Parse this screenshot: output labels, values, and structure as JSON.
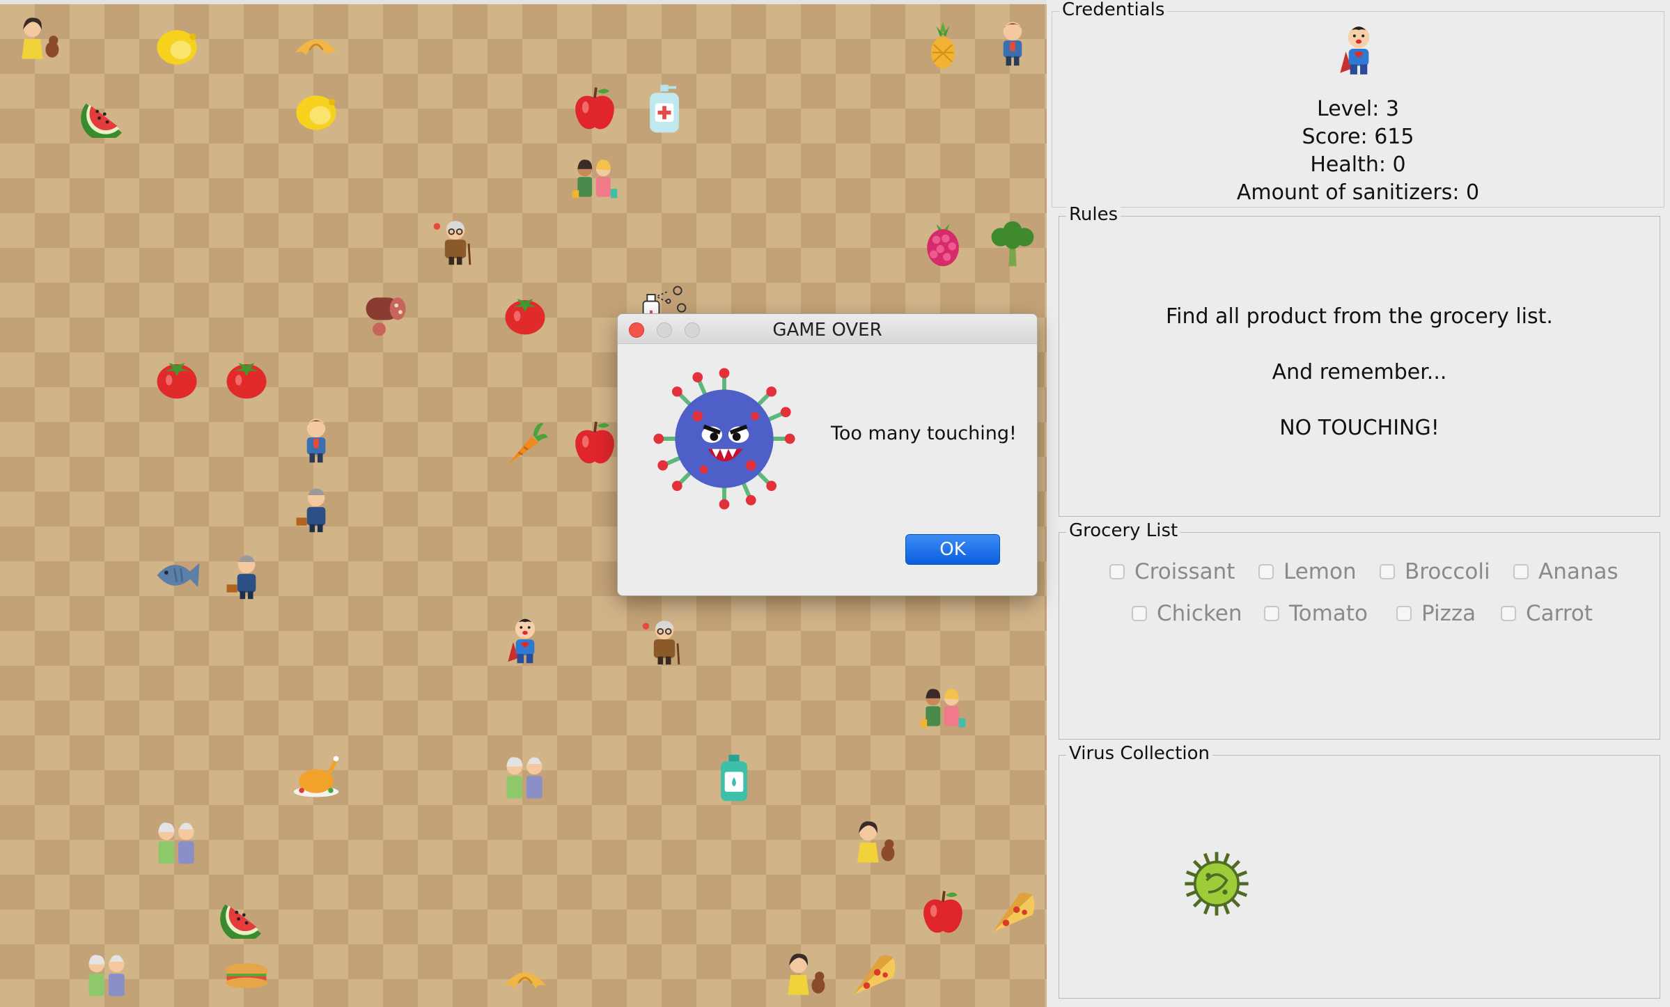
{
  "dialog": {
    "title": "GAME OVER",
    "message": "Too many touching!",
    "ok_label": "OK",
    "icon": "virus-icon"
  },
  "credentials": {
    "title": "Credentials",
    "avatar_icon": "player-icon",
    "level": "Level: 3",
    "score": "Score: 615",
    "health": "Health:  0",
    "sanitizers": "Amount of sanitizers: 0"
  },
  "rules": {
    "title": "Rules",
    "line1": "Find all product from the grocery list.",
    "line2": "And remember...",
    "line3": "NO TOUCHING!"
  },
  "grocery_list": {
    "title": "Grocery List",
    "items": [
      {
        "label": "Croissant",
        "checked": false
      },
      {
        "label": "Lemon",
        "checked": false
      },
      {
        "label": "Broccoli",
        "checked": false
      },
      {
        "label": "Ananas",
        "checked": false
      },
      {
        "label": "Chicken",
        "checked": false
      },
      {
        "label": "Tomato",
        "checked": false
      },
      {
        "label": "Pizza",
        "checked": false
      },
      {
        "label": "Carrot",
        "checked": false
      }
    ]
  },
  "virus_collection": {
    "title": "Virus Collection",
    "items": [
      "green-virus-icon"
    ]
  },
  "colors": {
    "board_light": "#d2b489",
    "board_dark": "#c4a277",
    "ok_button": "#1a6ef0",
    "close_dot": "#f2544c"
  },
  "board_items": [
    "woman-with-dog-icon",
    "lemon-icon",
    "croissant-icon",
    "pineapple-icon",
    "man-icon",
    "watermelon-icon",
    "lemon-icon",
    "apple-icon",
    "sanitizer-bottle-icon",
    "couple-shopping-icon",
    "old-man-icon",
    "raspberry-icon",
    "broccoli-icon",
    "salami-icon",
    "tomato-icon",
    "sanitizer-spray-icon",
    "tomato-icon",
    "tomato-icon",
    "man-icon",
    "carrot-icon",
    "apple-icon",
    "businessman-icon",
    "fish-icon",
    "businessman-icon",
    "player-icon",
    "old-man-icon",
    "couple-shopping-icon",
    "chicken-icon",
    "elderly-couple-icon",
    "sanitizer-bottle-icon",
    "elderly-couple-icon",
    "woman-with-dog-icon",
    "watermelon-icon",
    "apple-icon",
    "pizza-icon",
    "elderly-couple-icon",
    "sandwich-icon",
    "croissant-icon",
    "woman-with-dog-icon",
    "pizza-icon"
  ]
}
